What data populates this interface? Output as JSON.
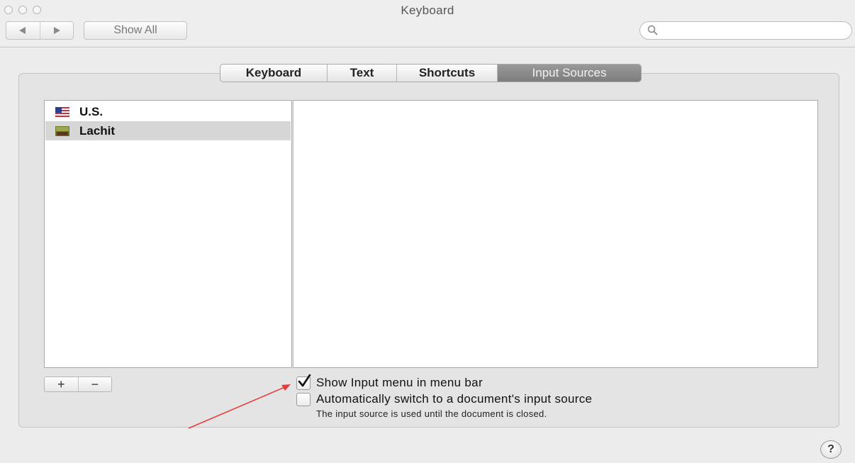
{
  "window": {
    "title": "Keyboard"
  },
  "toolbar": {
    "back_icon": "back-arrow",
    "forward_icon": "forward-arrow",
    "show_all_label": "Show All",
    "search_value": "",
    "search_placeholder": ""
  },
  "tabs": [
    {
      "label": "Keyboard",
      "active": false
    },
    {
      "label": "Text",
      "active": false
    },
    {
      "label": "Shortcuts",
      "active": false
    },
    {
      "label": "Input Sources",
      "active": true
    }
  ],
  "input_sources": [
    {
      "label": "U.S.",
      "icon": "us-flag-icon",
      "selected": false
    },
    {
      "label": "Lachit",
      "icon": "lachit-input-icon",
      "selected": true
    }
  ],
  "list_controls": {
    "add_label": "+",
    "remove_label": "−"
  },
  "options": {
    "show_input_menu": {
      "label": "Show Input menu in menu bar",
      "checked": true
    },
    "auto_switch": {
      "label": "Automatically switch to a document's input source",
      "checked": false
    },
    "auto_switch_note": "The input source is used until the document is closed."
  },
  "help_label": "?",
  "colors": {
    "annotation_arrow": "#e83a3a",
    "active_tab": "#8a8a8a"
  }
}
